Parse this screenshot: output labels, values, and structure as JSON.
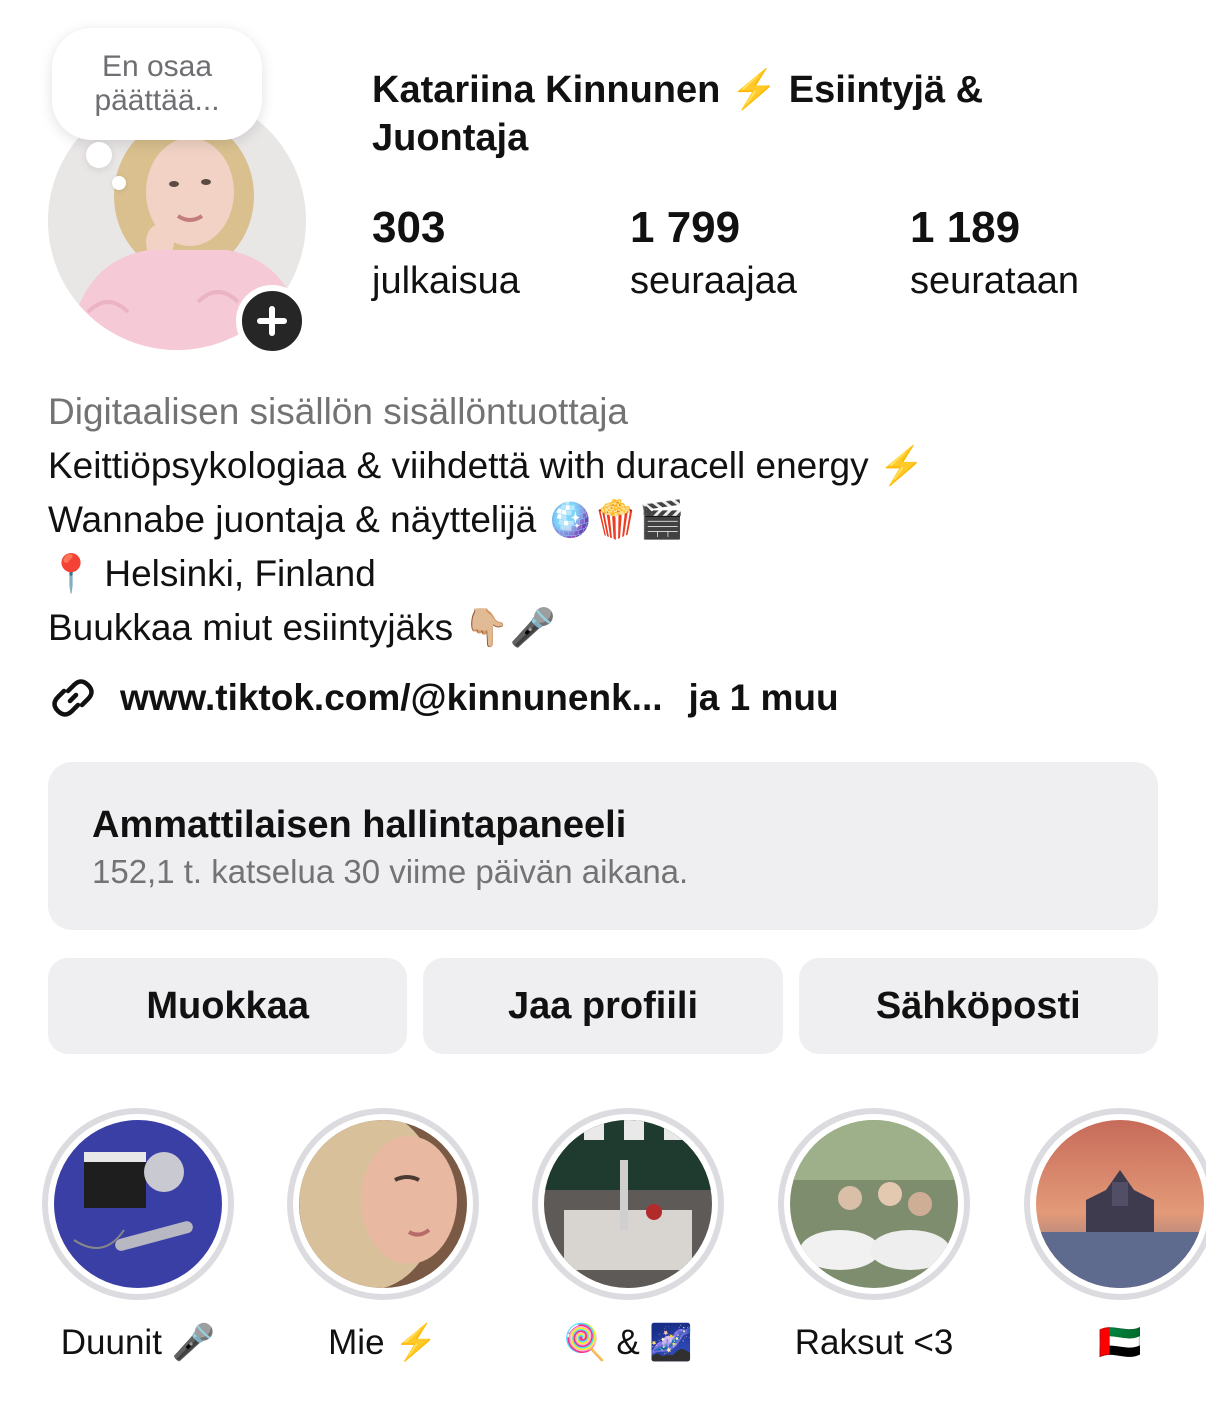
{
  "profile": {
    "note": "En osaa päättää...",
    "name": "Katariina Kinnunen ⚡️ Esiintyjä & Juontaja",
    "stats": [
      {
        "value": "303",
        "label": "julkaisua"
      },
      {
        "value": "1 799",
        "label": "seuraajaa"
      },
      {
        "value": "1 189",
        "label": "seurataan"
      }
    ]
  },
  "bio": {
    "category": "Digitaalisen sisällön sisällöntuottaja",
    "lines": [
      "Keittiöpsykologiaa & viihdettä with duracell energy ⚡️",
      "Wannabe juontaja & näyttelijä 🪩🍿🎬",
      "📍 Helsinki, Finland",
      "Buukkaa miut esiintyjäks 👇🏼🎤"
    ],
    "link": "www.tiktok.com/@kinnunenk...",
    "link_more": "ja 1 muu"
  },
  "dashboard": {
    "title": "Ammattilaisen hallintapaneeli",
    "subtitle": "152,1 t. katselua 30 viime päivän aikana."
  },
  "actions": [
    "Muokkaa",
    "Jaa profiili",
    "Sähköposti"
  ],
  "highlights": [
    {
      "label": "Duunit 🎤"
    },
    {
      "label": "Mie ⚡️"
    },
    {
      "label": "🍭 & 🌌"
    },
    {
      "label": "Raksut <3"
    },
    {
      "label": "🇦🇪"
    }
  ]
}
